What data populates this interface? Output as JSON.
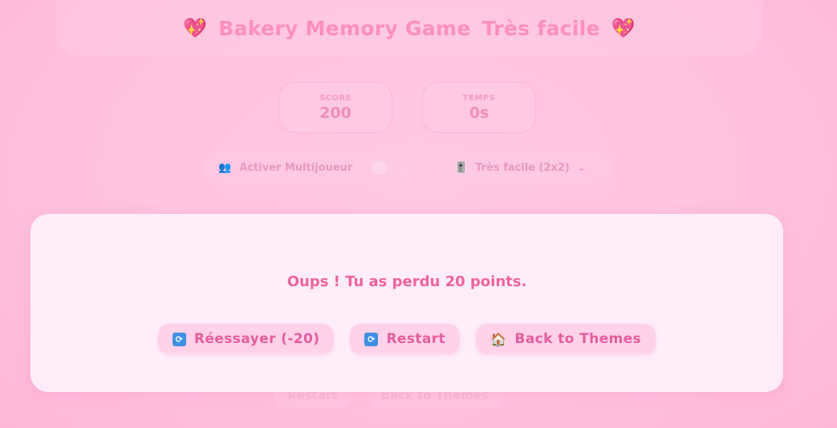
{
  "header": {
    "title": "Bakery Memory Game",
    "difficulty": "Très facile",
    "heart_left": "💖",
    "heart_right": "💖"
  },
  "stats": {
    "score_label": "SCORE",
    "score_value": "200",
    "time_label": "TEMPS",
    "time_value": "0s"
  },
  "controls": {
    "multiplayer_label": "Activer Multijoueur",
    "multiplayer_icon": "👥",
    "difficulty_select": "Très facile (2x2)",
    "difficulty_icon": "🎚️"
  },
  "background_buttons": {
    "restart_label": "Restart",
    "back_label": "Back to Themes"
  },
  "modal": {
    "message": "Oups ! Tu as perdu 20 points.",
    "retry_label": "Réessayer (-20)",
    "restart_label": "Restart",
    "back_label": "Back to Themes"
  },
  "colors": {
    "accent": "#f0629f",
    "modal_bg": "#ffeefa",
    "page_bg": "#ffc0df",
    "button_bg": "#ffd2ea"
  }
}
